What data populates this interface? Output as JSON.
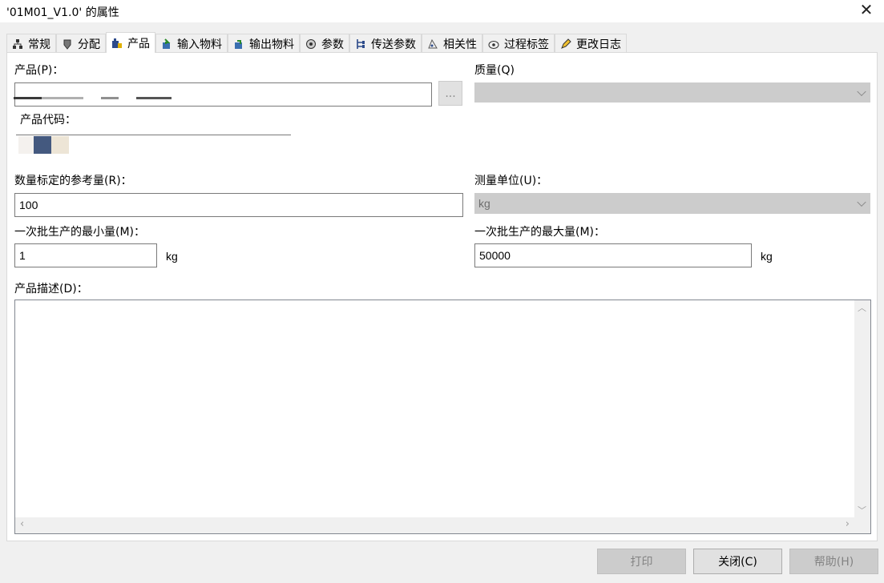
{
  "window": {
    "title": "'01M01_V1.0' 的属性",
    "close_glyph": "✕"
  },
  "tabs": [
    {
      "label": "常规",
      "icon": "network-icon",
      "active": false
    },
    {
      "label": "分配",
      "icon": "shield-icon",
      "active": false
    },
    {
      "label": "产品",
      "icon": "product-icon",
      "active": true
    },
    {
      "label": "输入物料",
      "icon": "input-material-icon",
      "active": false
    },
    {
      "label": "输出物料",
      "icon": "output-material-icon",
      "active": false
    },
    {
      "label": "参数",
      "icon": "parameter-icon",
      "active": false
    },
    {
      "label": "传送参数",
      "icon": "transfer-icon",
      "active": false
    },
    {
      "label": "相关性",
      "icon": "dependency-icon",
      "active": false
    },
    {
      "label": "过程标签",
      "icon": "tag-icon",
      "active": false
    },
    {
      "label": "更改日志",
      "icon": "pencil-icon",
      "active": false
    }
  ],
  "form": {
    "product_label": "产品(P)：",
    "product_value": "",
    "ellipsis_label": "...",
    "quality_label": "质量(Q)",
    "quality_value": "",
    "product_code_label": "产品代码：",
    "reference_label": "数量标定的参考量(R)：",
    "reference_value": "100",
    "unit_label": "测量单位(U)：",
    "unit_value": "kg",
    "min_label": "一次批生产的最小量(M)：",
    "min_value": "1",
    "min_unit": "kg",
    "max_label": "一次批生产的最大量(M)：",
    "max_value": "50000",
    "max_unit": "kg",
    "description_label": "产品描述(D)：",
    "description_value": ""
  },
  "buttons": {
    "print": "打印",
    "close": "关闭(C)",
    "help": "帮助(H)"
  },
  "colors": {
    "accent_swatch": "#44597f",
    "disabled_bg": "#cccccc"
  }
}
